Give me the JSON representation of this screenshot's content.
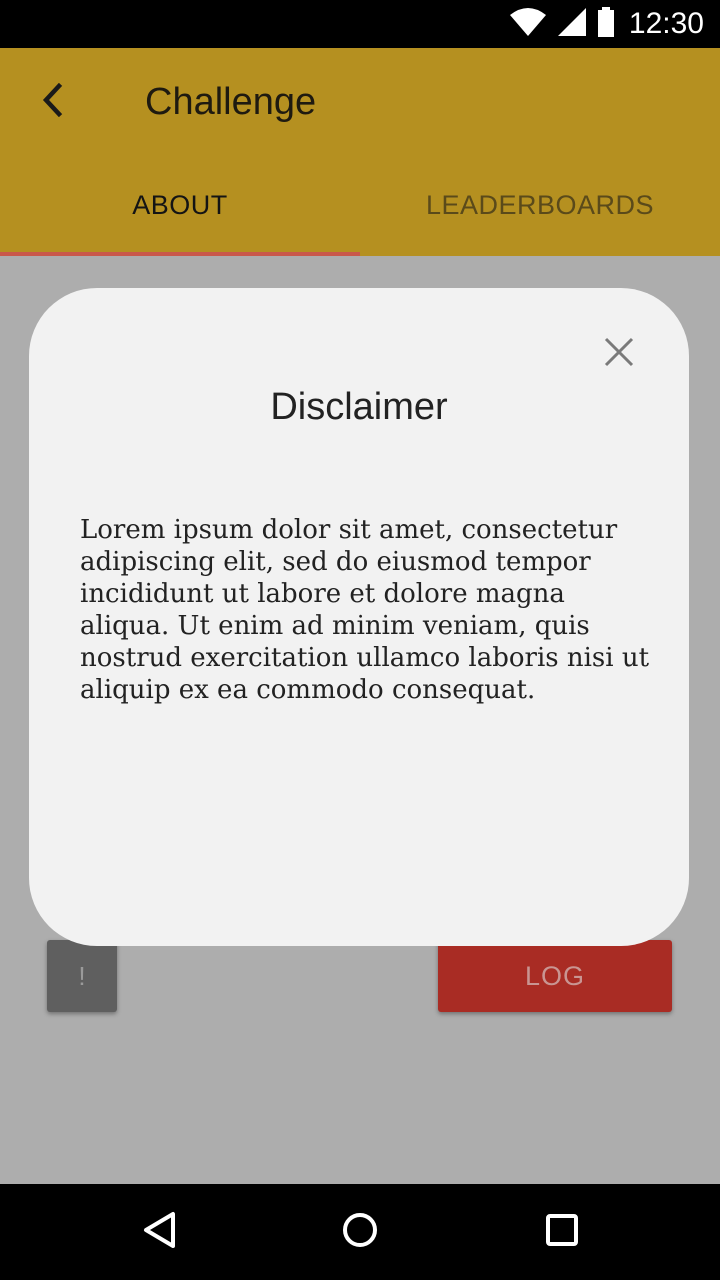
{
  "status_bar": {
    "time": "12:30",
    "icons": [
      "wifi-icon",
      "signal-icon",
      "battery-icon"
    ]
  },
  "app_bar": {
    "title": "Challenge",
    "back_icon": "chevron-left-icon",
    "background_color": "#b59020"
  },
  "tabs": [
    {
      "label": "ABOUT",
      "active": true
    },
    {
      "label": "LEADERBOARDS",
      "active": false
    }
  ],
  "content": {
    "info_button_label": "!",
    "log_button_label": "LOG",
    "log_button_color": "#a92c24"
  },
  "dialog": {
    "title": "Disclaimer",
    "close_icon": "close-icon",
    "body": "Lorem ipsum dolor sit amet, consectetur adipiscing elit, sed do eiusmod tempor incididunt ut labore et dolore magna aliqua. Ut enim ad minim veniam, quis nostrud exercitation ullamco laboris nisi ut aliquip ex ea commodo consequat."
  },
  "nav_bar": {
    "icons": [
      "back-triangle-icon",
      "home-circle-icon",
      "recents-square-icon"
    ]
  }
}
